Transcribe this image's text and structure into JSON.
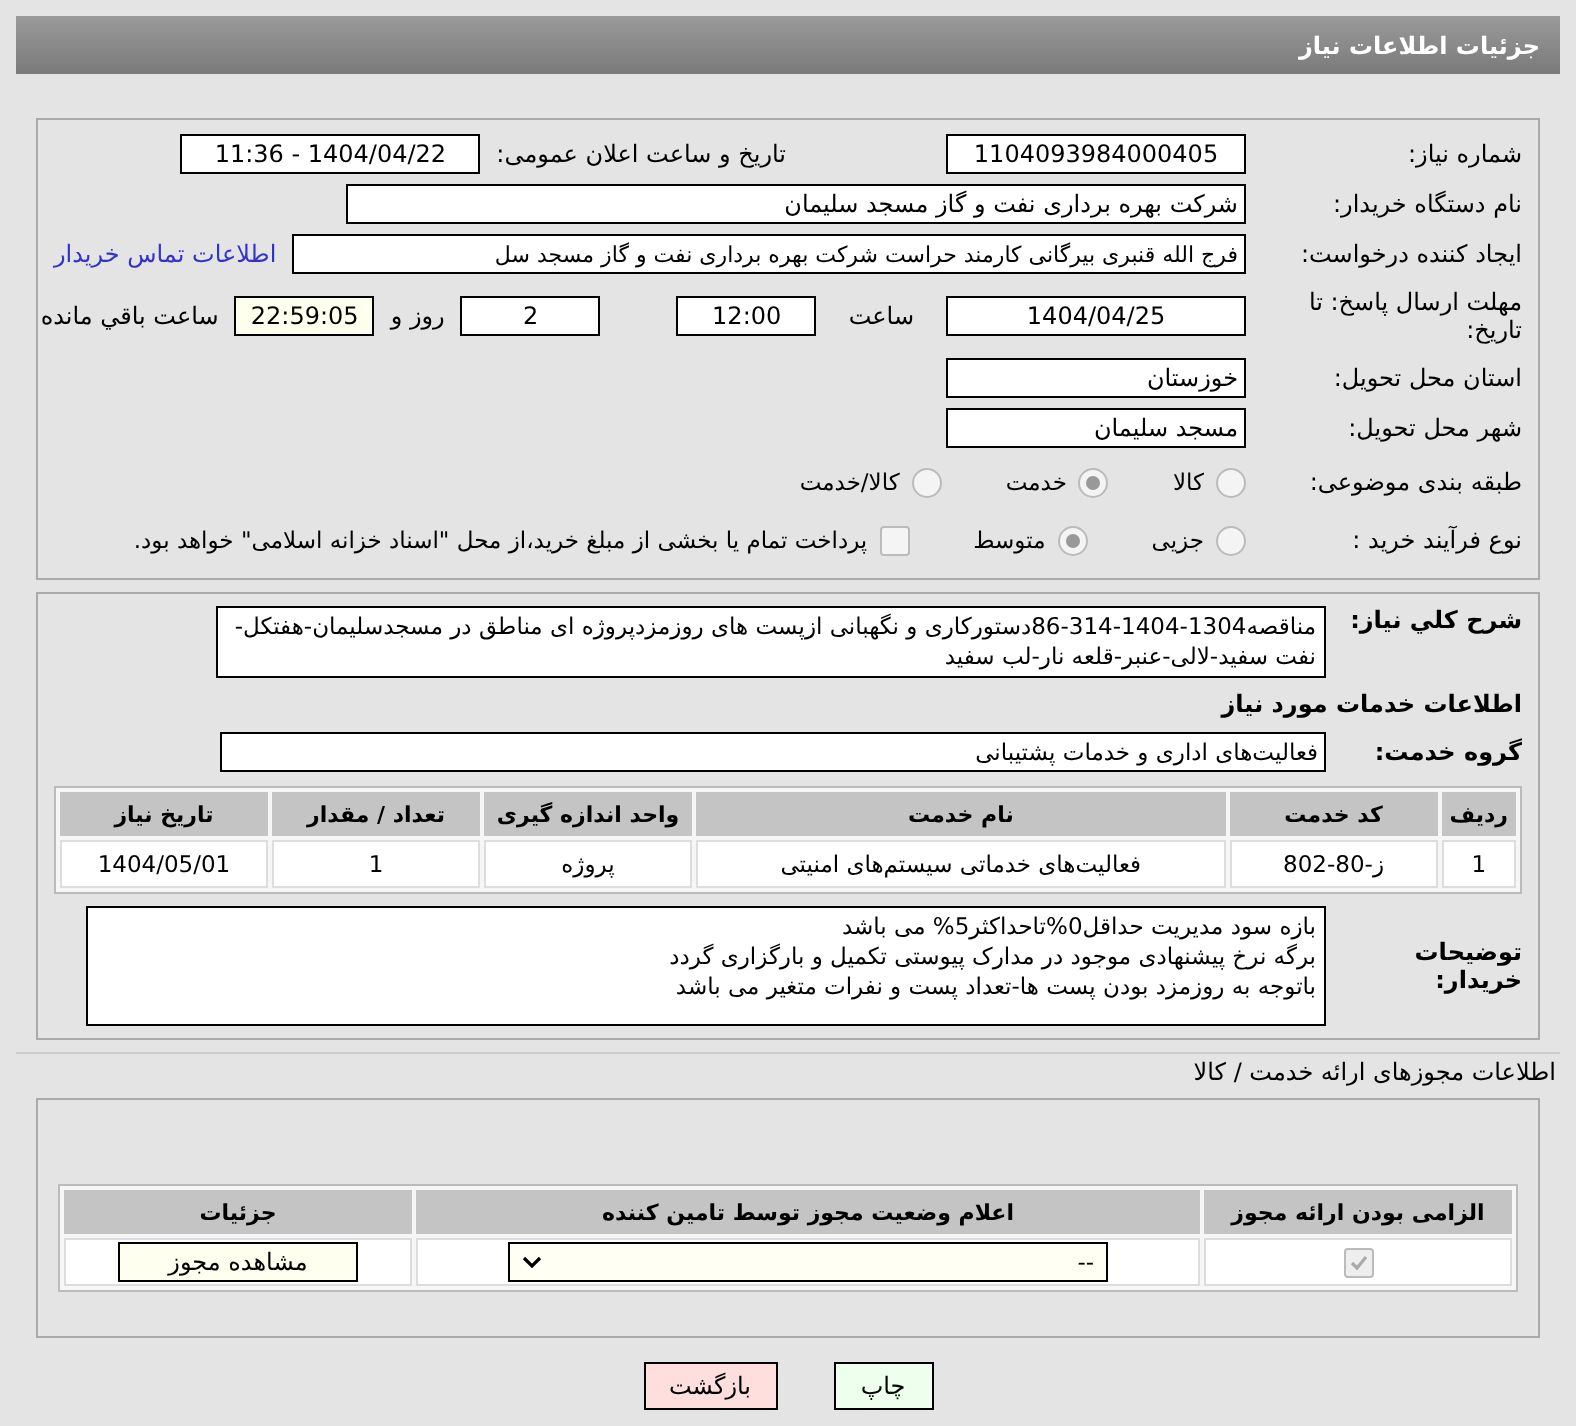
{
  "header": {
    "title": "جزئیات اطلاعات نیاز"
  },
  "need_info": {
    "need_number": {
      "label": "شماره نیاز:",
      "value": "1104093984000405"
    },
    "announce": {
      "label": "تاریخ و ساعت اعلان عمومی:",
      "value": "1404/04/22 - 11:36"
    },
    "buyer": {
      "label": "نام دستگاه خریدار:",
      "value": "شرکت بهره برداری نفت و گاز مسجد سلیمان"
    },
    "requester": {
      "label": "ایجاد کننده درخواست:",
      "value": "فرج الله قنبری بیرگانی کارمند حراست شرکت بهره برداری نفت و گاز مسجد سل",
      "link": "اطلاعات تماس خریدار"
    },
    "deadline": {
      "label": "مهلت ارسال پاسخ: تا تاریخ:",
      "date": "1404/04/25",
      "time_label": "ساعت",
      "time": "12:00",
      "days": "2",
      "days_label": "روز و",
      "remaining": "22:59:05",
      "remaining_label": "ساعت باقي مانده"
    },
    "province": {
      "label": "استان محل تحویل:",
      "value": "خوزستان"
    },
    "city": {
      "label": "شهر محل تحویل:",
      "value": "مسجد سلیمان"
    },
    "category": {
      "label": "طبقه بندی موضوعی:",
      "options": [
        {
          "label": "کالا",
          "selected": false
        },
        {
          "label": "خدمت",
          "selected": true
        },
        {
          "label": "کالا/خدمت",
          "selected": false
        }
      ]
    },
    "process": {
      "label": "نوع فرآیند خرید :",
      "options": [
        {
          "label": "جزیی",
          "selected": false
        },
        {
          "label": "متوسط",
          "selected": true
        }
      ],
      "payment": {
        "checked": false,
        "text": "پرداخت تمام یا بخشی از مبلغ خرید،از محل \"اسناد خزانه اسلامی\" خواهد بود."
      }
    }
  },
  "services": {
    "description": {
      "label": "شرح كلي نياز:",
      "value": "مناقصه1304-1404-314-86دستورکاری و نگهبانی ازپست های روزمزدپروژه ای مناطق در مسجدسلیمان-هفتکل-نفت سفید-لالی-عنبر-قلعه نار-لب سفید"
    },
    "title": "اطلاعات خدمات مورد نياز",
    "group": {
      "label": "گروه خدمت:",
      "value": "فعالیت‌های اداری و خدمات پشتیبانی"
    },
    "table": {
      "columns": [
        "ردیف",
        "کد خدمت",
        "نام خدمت",
        "واحد اندازه گیری",
        "تعداد / مقدار",
        "تاریخ نیاز"
      ],
      "rows": [
        [
          "1",
          "ز-80-802",
          "فعالیت‌های خدماتی سیستم‌های امنیتی",
          "پروژه",
          "1",
          "1404/05/01"
        ]
      ]
    },
    "notes": {
      "label": "توضیحات خریدار:",
      "lines": [
        "بازه سود مدیریت حداقل0%تاحداکثر5% می باشد",
        "برگه نرخ پیشنهادی موجود در مدارک پیوستی تکمیل و بارگزاری گردد",
        "باتوجه به روزمزد بودن پست ها-تعداد پست و نفرات متغیر می باشد"
      ]
    }
  },
  "permits": {
    "title": "اطلاعات مجوزهای ارائه خدمت / کالا",
    "columns": [
      "الزامی بودن ارائه مجوز",
      "اعلام وضعیت مجوز توسط تامین کننده",
      "جزئیات"
    ],
    "rows": [
      {
        "required": true,
        "status": "--",
        "action": "مشاهده مجوز"
      }
    ]
  },
  "buttons": [
    {
      "kind": "print",
      "label": "چاپ"
    },
    {
      "kind": "back",
      "label": "بازگشت"
    }
  ]
}
